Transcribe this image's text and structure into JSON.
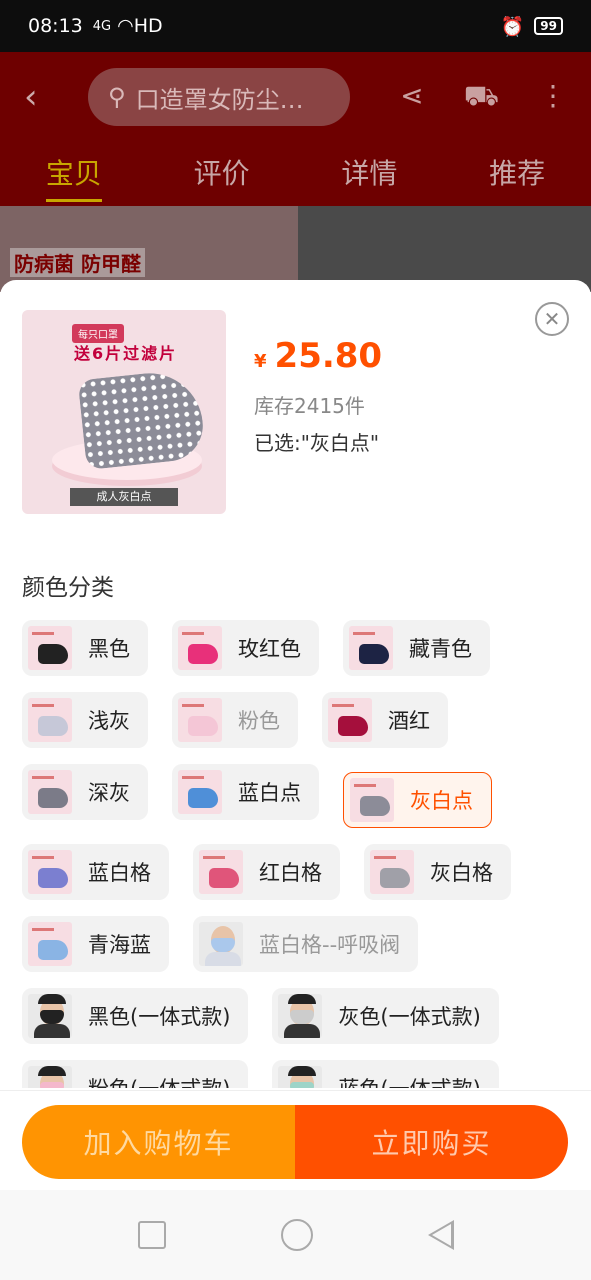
{
  "status_bar": {
    "time": "08:13",
    "signal": "4G",
    "network": "HD",
    "battery": "99"
  },
  "header": {
    "search_text": "口造罩女防尘…",
    "tabs": [
      "宝贝",
      "评价",
      "详情",
      "推荐"
    ],
    "promo_text": "防病菌 防甲醛"
  },
  "sheet": {
    "thumb": {
      "badge": "每只口罩",
      "headline": "送6片过滤片",
      "caption": "成人灰白点"
    },
    "currency": "¥",
    "price": "25.80",
    "stock": "库存2415件",
    "selected": "已选:\"灰白点\"",
    "section_title": "颜色分类",
    "colors": {
      "black": "#222222",
      "rose": "#e8307a",
      "navy": "#1d2344",
      "lightgray": "#c6c8d8",
      "pink": "#f4c6d6",
      "wine": "#a50f3c",
      "darkgray": "#7b7b88",
      "blue": "#4f8fd8",
      "accent": "#ff5000"
    },
    "options": [
      [
        "黑色",
        "玫红色",
        "藏青色"
      ],
      [
        "浅灰",
        "粉色",
        "酒红"
      ],
      [
        "深灰",
        "蓝白点",
        "灰白点"
      ],
      [
        "蓝白格",
        "红白格",
        "灰白格"
      ],
      [
        "青海蓝",
        "蓝白格--呼吸阀"
      ],
      [
        "黑色(一体式款)",
        "灰色(一体式款)"
      ],
      [
        "粉色(一体式款)",
        "蓝色(一体式款)"
      ]
    ]
  },
  "actions": {
    "add_to_cart": "加入购物车",
    "buy_now": "立即购买"
  }
}
